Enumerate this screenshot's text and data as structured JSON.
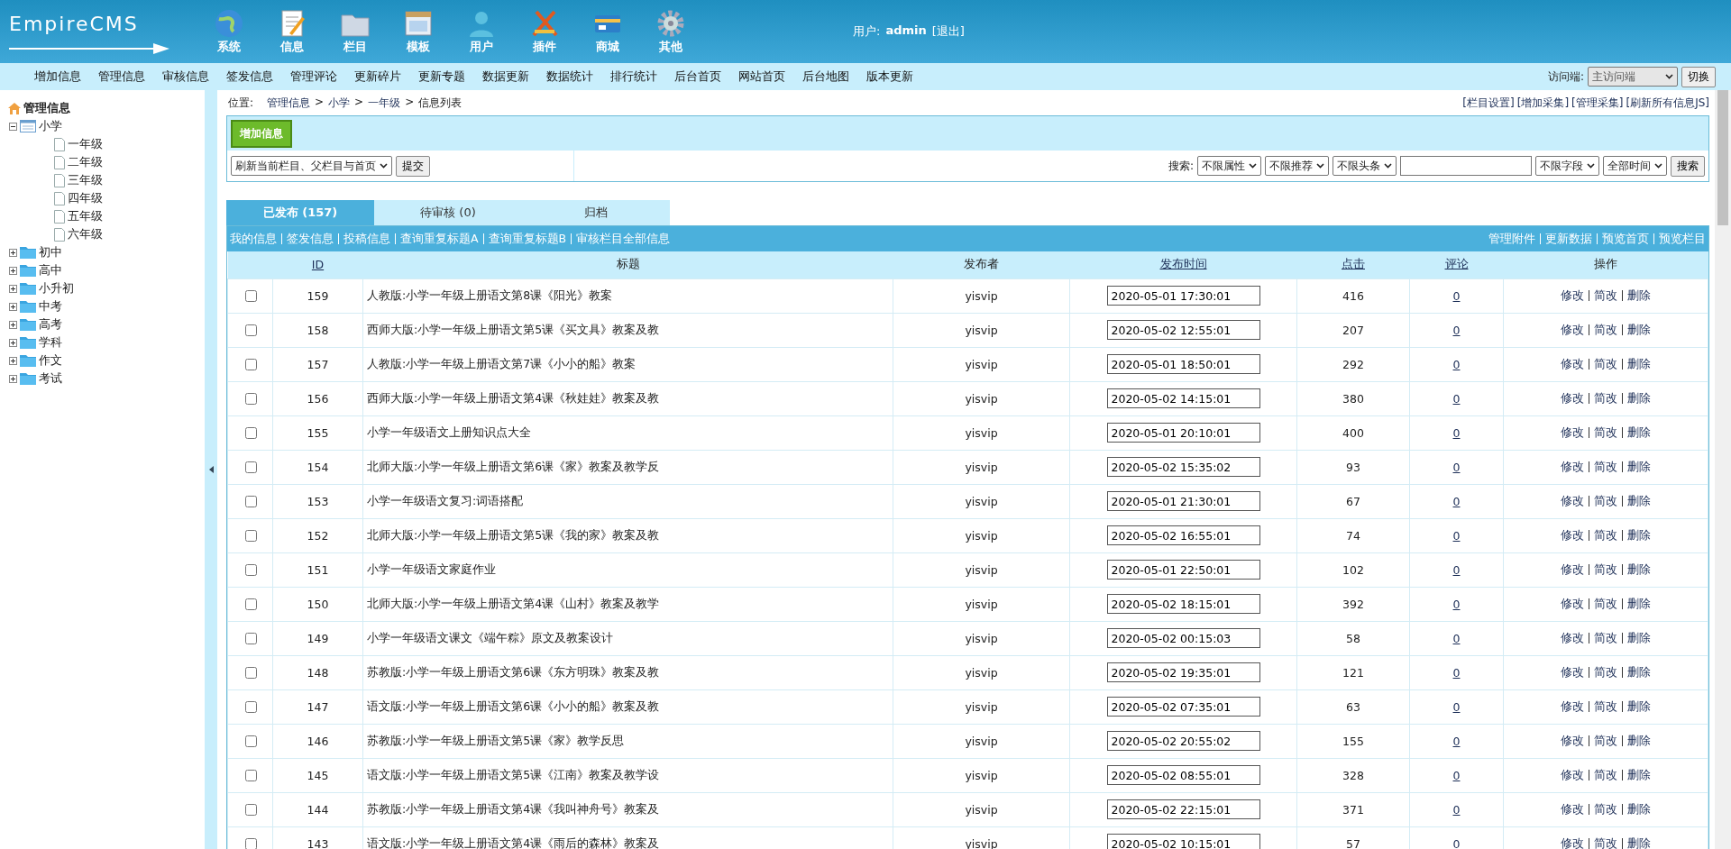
{
  "logo": {
    "text": "EmpireCMS"
  },
  "top_nav": [
    {
      "label": "系统"
    },
    {
      "label": "信息"
    },
    {
      "label": "栏目"
    },
    {
      "label": "模板"
    },
    {
      "label": "用户"
    },
    {
      "label": "插件"
    },
    {
      "label": "商城"
    },
    {
      "label": "其他"
    }
  ],
  "user": {
    "label": "用户:",
    "name": "admin",
    "logout": "[退出]"
  },
  "menu_bar": [
    "增加信息",
    "管理信息",
    "审核信息",
    "签发信息",
    "管理评论",
    "更新碎片",
    "更新专题",
    "数据更新",
    "数据统计",
    "排行统计",
    "后台首页",
    "网站首页",
    "后台地图",
    "版本更新"
  ],
  "visitor": {
    "label": "访问端:",
    "value": "主访问端",
    "button": "切换"
  },
  "tree": {
    "title": "管理信息",
    "items": [
      {
        "label": "小学",
        "expanded": true,
        "children": [
          {
            "label": "一年级"
          },
          {
            "label": "二年级"
          },
          {
            "label": "三年级"
          },
          {
            "label": "四年级"
          },
          {
            "label": "五年级"
          },
          {
            "label": "六年级"
          }
        ]
      },
      {
        "label": "初中",
        "expanded": false
      },
      {
        "label": "高中",
        "expanded": false
      },
      {
        "label": "小升初",
        "expanded": false
      },
      {
        "label": "中考",
        "expanded": false
      },
      {
        "label": "高考",
        "expanded": false
      },
      {
        "label": "学科",
        "expanded": false
      },
      {
        "label": "作文",
        "expanded": false
      },
      {
        "label": "考试",
        "expanded": false
      }
    ]
  },
  "breadcrumb": {
    "label": "位置:",
    "parts": [
      {
        "kind": "link",
        "text": "管理信息"
      },
      {
        "kind": "sep",
        "text": ">"
      },
      {
        "kind": "link",
        "text": "小学"
      },
      {
        "kind": "sep",
        "text": ">"
      },
      {
        "kind": "link",
        "text": "一年级"
      },
      {
        "kind": "sep",
        "text": ">"
      },
      {
        "kind": "text",
        "text": "信息列表"
      }
    ]
  },
  "top_links": [
    "[栏目设置]",
    "[增加采集]",
    "[管理采集]",
    "[刷新所有信息JS]"
  ],
  "add_button": "增加信息",
  "refresh": {
    "value": "刷新当前栏目、父栏目与首页",
    "button": "提交"
  },
  "search": {
    "label": "搜索:",
    "filters": [
      "不限属性",
      "不限推荐",
      "不限头条"
    ],
    "fields": [
      "不限字段",
      "全部时间"
    ],
    "button": "搜索"
  },
  "tabs": [
    {
      "label": "已发布 (157)",
      "selected": true
    },
    {
      "label": "待审核 (0)",
      "selected": false
    },
    {
      "label": "归档",
      "selected": false
    }
  ],
  "links_left": [
    "我的信息",
    "签发信息",
    "投稿信息",
    "查询重复标题A",
    "查询重复标题B",
    "审核栏目全部信息"
  ],
  "links_right": [
    "管理附件",
    "更新数据",
    "预览首页",
    "预览栏目"
  ],
  "table": {
    "columns": [
      {
        "label": "ID",
        "link": true
      },
      {
        "label": "标题",
        "link": false
      },
      {
        "label": "发布者",
        "link": false
      },
      {
        "label": "发布时间",
        "link": true
      },
      {
        "label": "点击",
        "link": true
      },
      {
        "label": "评论",
        "link": true
      },
      {
        "label": "操作",
        "link": false
      }
    ],
    "rows": [
      {
        "checked": false,
        "id": "159",
        "title": "人教版:小学一年级上册语文第8课《阳光》教案",
        "author": "yisvip",
        "time": "2020-05-01 17:30:01",
        "clicks": "416",
        "comments": "0",
        "actions": [
          "修改",
          "简改",
          "删除"
        ]
      },
      {
        "checked": false,
        "id": "158",
        "title": "西师大版:小学一年级上册语文第5课《买文具》教案及教",
        "author": "yisvip",
        "time": "2020-05-02 12:55:01",
        "clicks": "207",
        "comments": "0",
        "actions": [
          "修改",
          "简改",
          "删除"
        ]
      },
      {
        "checked": false,
        "id": "157",
        "title": "人教版:小学一年级上册语文第7课《小小的船》教案",
        "author": "yisvip",
        "time": "2020-05-01 18:50:01",
        "clicks": "292",
        "comments": "0",
        "actions": [
          "修改",
          "简改",
          "删除"
        ]
      },
      {
        "checked": false,
        "id": "156",
        "title": "西师大版:小学一年级上册语文第4课《秋娃娃》教案及教",
        "author": "yisvip",
        "time": "2020-05-02 14:15:01",
        "clicks": "380",
        "comments": "0",
        "actions": [
          "修改",
          "简改",
          "删除"
        ]
      },
      {
        "checked": false,
        "id": "155",
        "title": "小学一年级语文上册知识点大全",
        "author": "yisvip",
        "time": "2020-05-01 20:10:01",
        "clicks": "400",
        "comments": "0",
        "actions": [
          "修改",
          "简改",
          "删除"
        ]
      },
      {
        "checked": false,
        "id": "154",
        "title": "北师大版:小学一年级上册语文第6课《家》教案及教学反",
        "author": "yisvip",
        "time": "2020-05-02 15:35:02",
        "clicks": "93",
        "comments": "0",
        "actions": [
          "修改",
          "简改",
          "删除"
        ]
      },
      {
        "checked": false,
        "id": "153",
        "title": "小学一年级语文复习:词语搭配",
        "author": "yisvip",
        "time": "2020-05-01 21:30:01",
        "clicks": "67",
        "comments": "0",
        "actions": [
          "修改",
          "简改",
          "删除"
        ]
      },
      {
        "checked": false,
        "id": "152",
        "title": "北师大版:小学一年级上册语文第5课《我的家》教案及教",
        "author": "yisvip",
        "time": "2020-05-02 16:55:01",
        "clicks": "74",
        "comments": "0",
        "actions": [
          "修改",
          "简改",
          "删除"
        ]
      },
      {
        "checked": false,
        "id": "151",
        "title": "小学一年级语文家庭作业",
        "author": "yisvip",
        "time": "2020-05-01 22:50:01",
        "clicks": "102",
        "comments": "0",
        "actions": [
          "修改",
          "简改",
          "删除"
        ]
      },
      {
        "checked": false,
        "id": "150",
        "title": "北师大版:小学一年级上册语文第4课《山村》教案及教学",
        "author": "yisvip",
        "time": "2020-05-02 18:15:01",
        "clicks": "392",
        "comments": "0",
        "actions": [
          "修改",
          "简改",
          "删除"
        ]
      },
      {
        "checked": false,
        "id": "149",
        "title": "小学一年级语文课文《端午粽》原文及教案设计",
        "author": "yisvip",
        "time": "2020-05-02 00:15:03",
        "clicks": "58",
        "comments": "0",
        "actions": [
          "修改",
          "简改",
          "删除"
        ]
      },
      {
        "checked": false,
        "id": "148",
        "title": "苏教版:小学一年级上册语文第6课《东方明珠》教案及教",
        "author": "yisvip",
        "time": "2020-05-02 19:35:01",
        "clicks": "121",
        "comments": "0",
        "actions": [
          "修改",
          "简改",
          "删除"
        ]
      },
      {
        "checked": false,
        "id": "147",
        "title": "语文版:小学一年级上册语文第6课《小小的船》教案及教",
        "author": "yisvip",
        "time": "2020-05-02 07:35:01",
        "clicks": "63",
        "comments": "0",
        "actions": [
          "修改",
          "简改",
          "删除"
        ]
      },
      {
        "checked": false,
        "id": "146",
        "title": "苏教版:小学一年级上册语文第5课《家》教学反思",
        "author": "yisvip",
        "time": "2020-05-02 20:55:02",
        "clicks": "155",
        "comments": "0",
        "actions": [
          "修改",
          "简改",
          "删除"
        ]
      },
      {
        "checked": false,
        "id": "145",
        "title": "语文版:小学一年级上册语文第5课《江南》教案及教学设",
        "author": "yisvip",
        "time": "2020-05-02 08:55:01",
        "clicks": "328",
        "comments": "0",
        "actions": [
          "修改",
          "简改",
          "删除"
        ]
      },
      {
        "checked": false,
        "id": "144",
        "title": "苏教版:小学一年级上册语文第4课《我叫神舟号》教案及",
        "author": "yisvip",
        "time": "2020-05-02 22:15:01",
        "clicks": "371",
        "comments": "0",
        "actions": [
          "修改",
          "简改",
          "删除"
        ]
      },
      {
        "checked": false,
        "id": "143",
        "title": "语文版:小学一年级上册语文第4课《雨后的森林》教案及",
        "author": "yisvip",
        "time": "2020-05-02 10:15:01",
        "clicks": "57",
        "comments": "0",
        "actions": [
          "修改",
          "简改",
          "删除"
        ]
      }
    ]
  }
}
